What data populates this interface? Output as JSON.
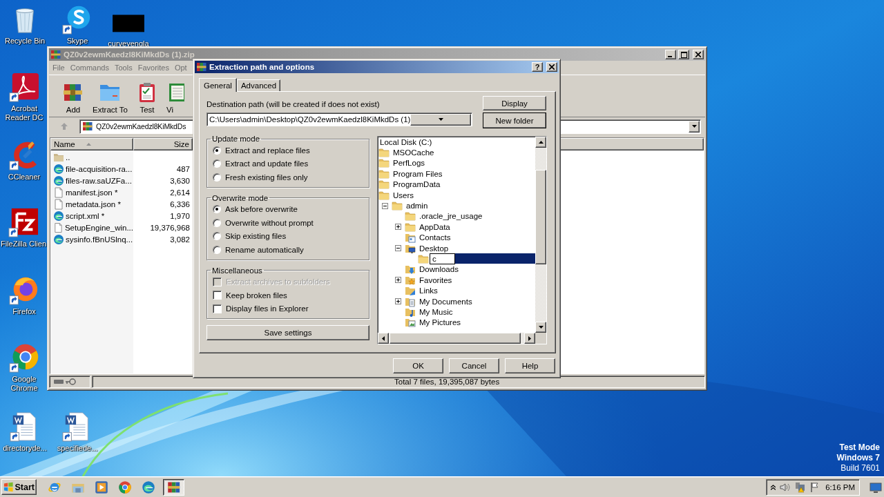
{
  "desktop": {
    "icons": [
      {
        "label": "Recycle Bin",
        "kind": "recycle-bin"
      },
      {
        "label": "Skype",
        "kind": "chat"
      },
      {
        "label": "curveyengla",
        "kind": "redacted"
      },
      {
        "label": "Acrobat Reader DC",
        "kind": "reader"
      },
      {
        "label": "CCleaner",
        "kind": "cleaner"
      },
      {
        "label": "FileZilla Clien",
        "kind": "ftp"
      },
      {
        "label": "Firefox",
        "kind": "firefox"
      },
      {
        "label": "Google Chrome",
        "kind": "chrome"
      },
      {
        "label": "directoryde...",
        "kind": "word"
      },
      {
        "label": "specifiede...",
        "kind": "word"
      }
    ],
    "system_notice": [
      "Test Mode",
      "Windows 7",
      "Build 7601"
    ]
  },
  "archive_window": {
    "title": "QZ0v2ewmKaedzl8KiMkdDs (1).zip",
    "menu": [
      "File",
      "Commands",
      "Tools",
      "Favorites",
      "Opt"
    ],
    "toolbar": [
      {
        "label": "Add",
        "kind": "add"
      },
      {
        "label": "Extract To",
        "kind": "extract"
      },
      {
        "label": "Test",
        "kind": "test"
      },
      {
        "label": "Vi",
        "kind": "view"
      }
    ],
    "address": "QZ0v2ewmKaedzl8KiMkdDs",
    "columns": [
      "Name",
      "Size"
    ],
    "rows": [
      {
        "name": "..",
        "kind": "up"
      },
      {
        "name": "file-acquisition-ra...",
        "size": "487",
        "kind": "edge"
      },
      {
        "name": "files-raw.saUZFa...",
        "size": "3,630",
        "kind": "edge"
      },
      {
        "name": "manifest.json *",
        "size": "2,614",
        "kind": "file"
      },
      {
        "name": "metadata.json *",
        "size": "6,336",
        "kind": "file"
      },
      {
        "name": "script.xml *",
        "size": "1,970",
        "kind": "edge"
      },
      {
        "name": "SetupEngine_win...",
        "size": "19,376,968",
        "kind": "file"
      },
      {
        "name": "sysinfo.fBnUSlnq...",
        "size": "3,082",
        "kind": "edge"
      }
    ],
    "status": "Total 7 files, 19,395,087 bytes"
  },
  "dialog": {
    "title": "Extraction path and options",
    "help_button": "?",
    "tabs": [
      {
        "label": "General",
        "selected": true
      },
      {
        "label": "Advanced",
        "selected": false
      }
    ],
    "destination_label": "Destination path (will be created if does not exist)",
    "destination_value": "C:\\Users\\admin\\Desktop\\QZ0v2ewmKaedzl8KiMkdDs (1)",
    "side_buttons": [
      {
        "label": "Display",
        "default": false
      },
      {
        "label": "New folder",
        "default": true
      }
    ],
    "groups": [
      {
        "title": "Update mode",
        "kind": "radio",
        "options": [
          {
            "label": "Extract and replace files",
            "selected": true
          },
          {
            "label": "Extract and update files",
            "selected": false
          },
          {
            "label": "Fresh existing files only",
            "selected": false
          }
        ]
      },
      {
        "title": "Overwrite mode",
        "kind": "radio",
        "options": [
          {
            "label": "Ask before overwrite",
            "selected": true
          },
          {
            "label": "Overwrite without prompt",
            "selected": false
          },
          {
            "label": "Skip existing files",
            "selected": false
          },
          {
            "label": "Rename automatically",
            "selected": false
          }
        ]
      },
      {
        "title": "Miscellaneous",
        "kind": "checkbox",
        "options": [
          {
            "label": "Extract archives to subfolders",
            "checked": false,
            "disabled": true
          },
          {
            "label": "Keep broken files",
            "checked": false,
            "disabled": false
          },
          {
            "label": "Display files in Explorer",
            "checked": false,
            "disabled": false
          }
        ]
      }
    ],
    "save_button": "Save settings",
    "tree": [
      {
        "label": "Local Disk (C:)",
        "kind": "drive",
        "selected": false,
        "children": [
          {
            "label": "MSOCache",
            "kind": "folder",
            "selected": false
          },
          {
            "label": "PerfLogs",
            "kind": "folder",
            "selected": false
          },
          {
            "label": "Program Files",
            "kind": "folder",
            "selected": false
          },
          {
            "label": "ProgramData",
            "kind": "folder",
            "selected": false
          },
          {
            "label": "Users",
            "kind": "folder",
            "selected": false,
            "children": [
              {
                "label": "admin",
                "kind": "folder",
                "selected": false,
                "expanded": true,
                "children": [
                  {
                    "label": ".oracle_jre_usage",
                    "kind": "folder",
                    "selected": false
                  },
                  {
                    "label": "AppData",
                    "kind": "folder",
                    "selected": false,
                    "expanded": false
                  },
                  {
                    "label": "Contacts",
                    "kind": "contacts",
                    "selected": false
                  },
                  {
                    "label": "Desktop",
                    "kind": "desktop",
                    "selected": false,
                    "expanded": true,
                    "children": [
                      {
                        "value": "c",
                        "kind": "rename",
                        "selected": true
                      }
                    ]
                  },
                  {
                    "label": "Downloads",
                    "kind": "downloads",
                    "selected": false
                  },
                  {
                    "label": "Favorites",
                    "kind": "favorites",
                    "selected": false,
                    "expanded": false
                  },
                  {
                    "label": "Links",
                    "kind": "links",
                    "selected": false
                  },
                  {
                    "label": "My Documents",
                    "kind": "documents",
                    "selected": false,
                    "expanded": false
                  },
                  {
                    "label": "My Music",
                    "kind": "music",
                    "selected": false
                  },
                  {
                    "label": "My Pictures",
                    "kind": "pictures",
                    "selected": false
                  }
                ]
              }
            ]
          }
        ]
      }
    ],
    "buttons": [
      "OK",
      "Cancel",
      "Help"
    ]
  },
  "taskbar": {
    "start": "Start",
    "apps": [
      {
        "kind": "ie",
        "selected": false
      },
      {
        "kind": "explorer",
        "selected": false
      },
      {
        "kind": "media",
        "selected": false
      },
      {
        "kind": "chrome",
        "selected": false
      },
      {
        "kind": "edge",
        "selected": false
      },
      {
        "kind": "winrar",
        "selected": true
      }
    ],
    "clock": "6:16 PM"
  }
}
